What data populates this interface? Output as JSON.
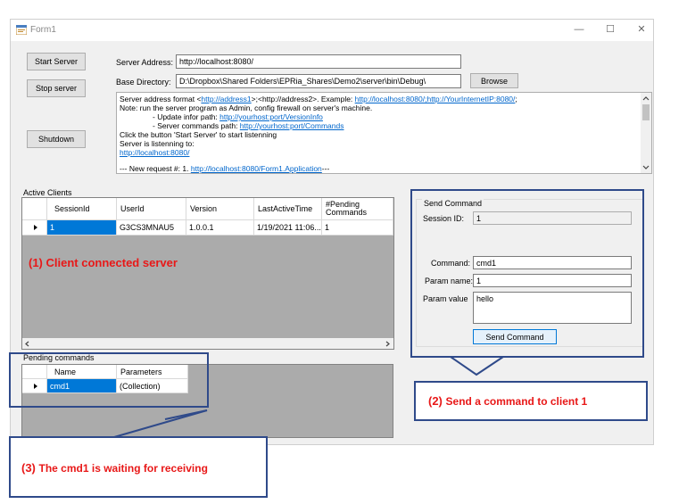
{
  "window": {
    "title": "Form1",
    "controls": {
      "minimize": "—",
      "maximize": "☐",
      "close": "✕"
    }
  },
  "buttons": {
    "start_server": "Start Server",
    "stop_server": "Stop server",
    "shutdown": "Shutdown",
    "browse": "Browse",
    "send_command": "Send Command"
  },
  "server": {
    "address_label": "Server Address:",
    "address_value": "http://localhost:8080/",
    "base_dir_label": "Base Directory:",
    "base_dir_value": "D:\\Dropbox\\Shared Folders\\EPRia_Shares\\Demo2\\server\\bin\\Debug\\"
  },
  "log": {
    "l1_a": "Server address format <",
    "l1_b": "http://address1",
    "l1_c": ">;<http://address2>. Example: ",
    "l1_d": "http://localhost:8080/;http://YourInternetIP:8080/",
    "l1_e": ";",
    "l2": "Note: run the server program as Admin, config firewall on server's machine.",
    "l3_a": "- Update infor path: ",
    "l3_b": "http://yourhost:port/VersionInfo",
    "l4_a": "- Server commands path: ",
    "l4_b": "http://yourhost:port/Commands",
    "l5": "Click the button 'Start Server' to start listenning",
    "l6": "Server is listenning to:",
    "l7": "http://localhost:8080/",
    "l8_a": "--- New request #: 1. ",
    "l8_b": "http://localhost:8080/Form1.Application",
    "l8_c": "---"
  },
  "active_clients": {
    "label": "Active Clients",
    "columns": [
      "SessionId",
      "UserId",
      "Version",
      "LastActiveTime",
      "#Pending Commands"
    ],
    "rows": [
      {
        "session_id": "1",
        "user_id": "G3CS3MNAU5",
        "version": "1.0.0.1",
        "last_active": "1/19/2021 11:06...",
        "pending": "1"
      }
    ]
  },
  "pending_commands": {
    "label": "Pending commands",
    "columns": [
      "Name",
      "Parameters"
    ],
    "rows": [
      {
        "name": "cmd1",
        "parameters": "(Collection)"
      }
    ]
  },
  "send_command": {
    "group_label": "Send Command",
    "session_id_label": "Session ID:",
    "session_id_value": "1",
    "command_label": "Command:",
    "command_value": "cmd1",
    "param_name_label": "Param name:",
    "param_name_value": "1",
    "param_value_label": "Param value",
    "param_value_value": "hello"
  },
  "annotations": {
    "a1_num": "(1)",
    "a1_text": "Client connected server",
    "a2_num": "(2)",
    "a2_text": "Send a command to client 1",
    "a3_num": "(3)",
    "a3_text": "The cmd1 is waiting for receiving"
  },
  "colors": {
    "annotation_text": "#e81818",
    "callout_border": "#2f4a8a",
    "selection": "#0078d7",
    "link": "#0066cc"
  }
}
